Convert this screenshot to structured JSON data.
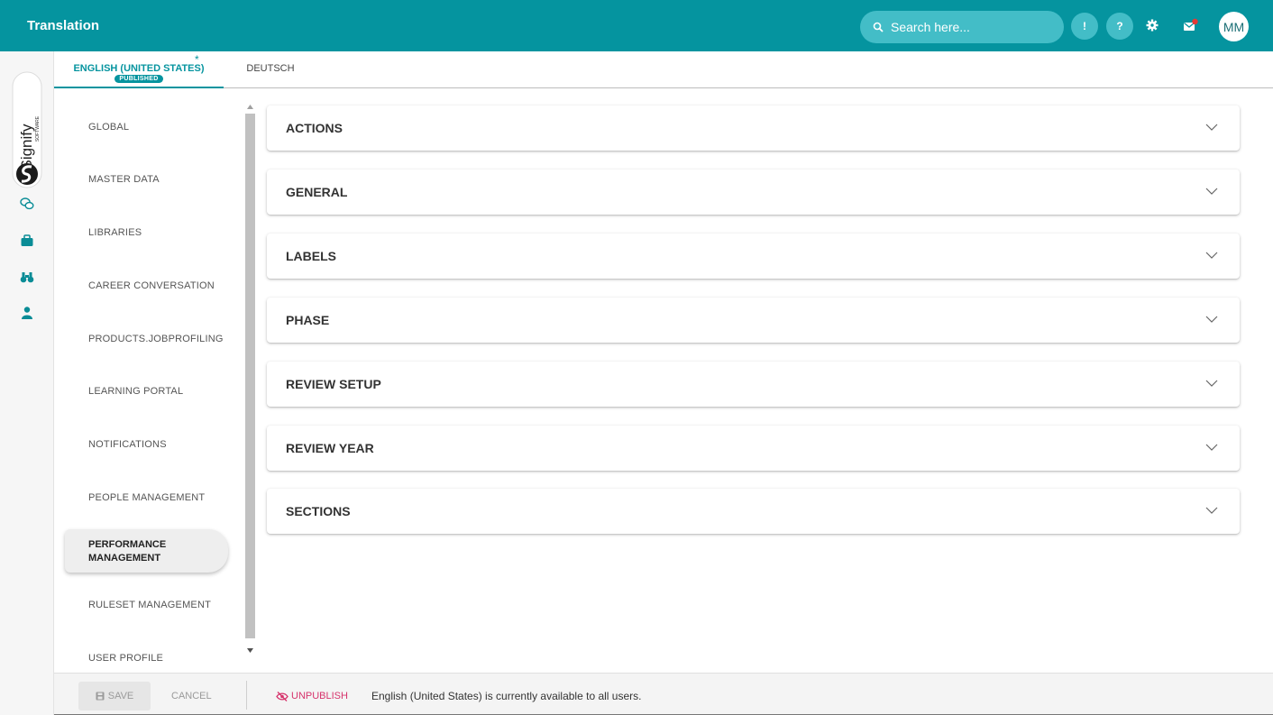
{
  "header": {
    "title": "Translation",
    "search_placeholder": "Search here...",
    "info_label": "!",
    "help_label": "?",
    "avatar_initials": "MM",
    "accent": "#05949f"
  },
  "brand": {
    "name": "Signify",
    "sub": "SOFTWARE"
  },
  "tabs": [
    {
      "label": "ENGLISH (UNITED STATES)",
      "badge": "PUBLISHED",
      "modified_marker": "*",
      "active": true
    },
    {
      "label": "DEUTSCH",
      "active": false
    }
  ],
  "categories": [
    "GLOBAL",
    "MASTER DATA",
    "LIBRARIES",
    "CAREER CONVERSATION",
    "PRODUCTS.JOBPROFILING",
    "LEARNING PORTAL",
    "NOTIFICATIONS",
    "PEOPLE MANAGEMENT",
    "PERFORMANCE MANAGEMENT",
    "RULESET MANAGEMENT",
    "USER PROFILE"
  ],
  "active_category": {
    "line1": "PERFORMANCE",
    "line2": "MANAGEMENT"
  },
  "sections": [
    "ACTIONS",
    "GENERAL",
    "LABELS",
    "PHASE",
    "REVIEW SETUP",
    "REVIEW YEAR",
    "SECTIONS"
  ],
  "footer": {
    "save_label": "SAVE",
    "cancel_label": "CANCEL",
    "unpublish_label": "UNPUBLISH",
    "status_text": "English (United States) is currently available to all users."
  }
}
